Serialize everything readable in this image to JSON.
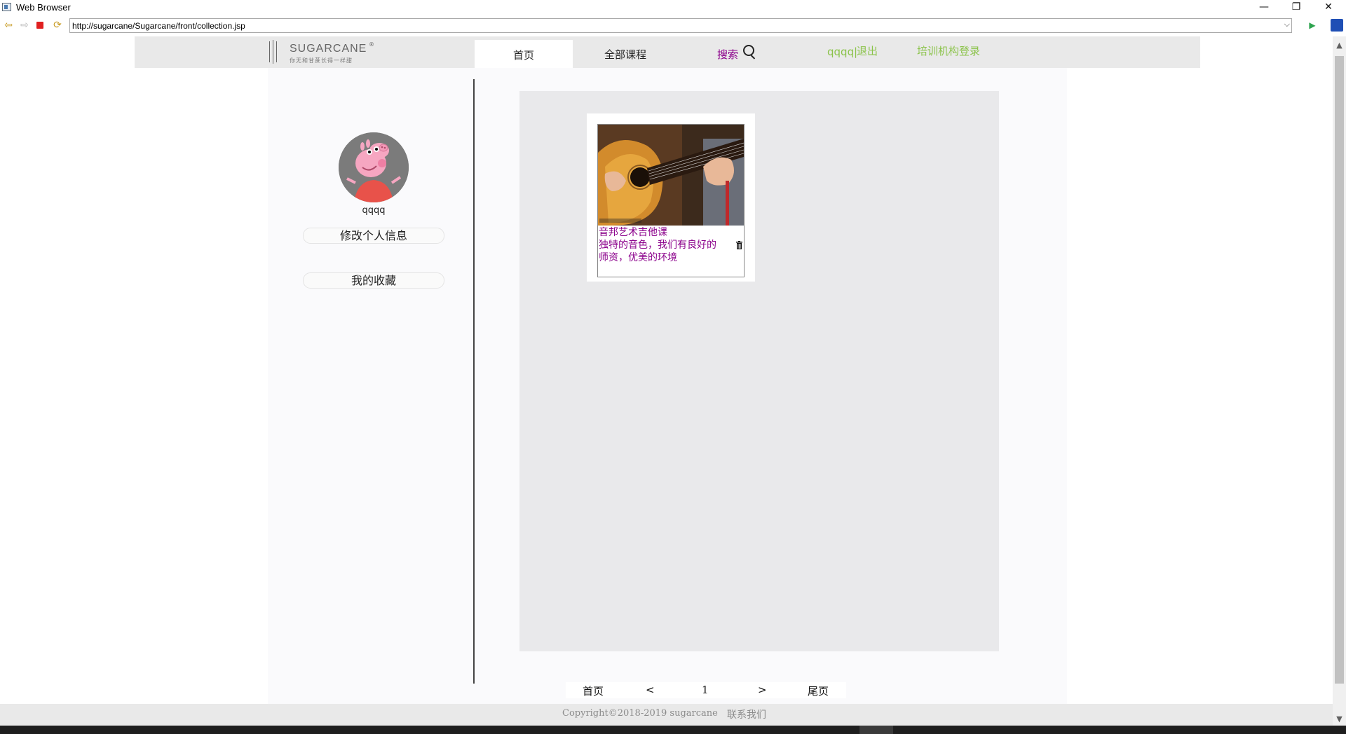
{
  "window": {
    "title": "Web Browser",
    "minimize_glyph": "—",
    "restore_glyph": "❐",
    "close_glyph": "✕"
  },
  "toolbar": {
    "url": "http://sugarcane/Sugarcane/front/collection.jsp",
    "back_glyph": "⇦",
    "forward_glyph": "⇨",
    "refresh_glyph": "⟳",
    "dropdown_glyph": "⌵",
    "go_glyph": "▶"
  },
  "header": {
    "logo_text": "SUGARCANE",
    "logo_reg": "®",
    "logo_slogan": "你无和甘蔗长得一样甜",
    "home_tab": "首页",
    "all_courses": "全部课程",
    "search": "搜索",
    "username": "qqqq",
    "separator": "|",
    "logout": "退出",
    "org_login": "培训机构登录"
  },
  "sidebar": {
    "username": "qqqq",
    "edit_profile": "修改个人信息",
    "my_favorites": "我的收藏"
  },
  "collection": {
    "items": [
      {
        "title": "音邦艺术吉他课",
        "description": "独特的音色，我们有良好的师资，优美的环境"
      }
    ]
  },
  "pagination": {
    "first": "首页",
    "prev": "<",
    "current": "1",
    "next": ">",
    "last": "尾页"
  },
  "footer": {
    "copyright": "Copyright©2018-2019   sugarcane",
    "contact": "联系我们"
  },
  "colors": {
    "accent_purple": "#8b008b",
    "accent_green": "#8bc34a",
    "nav_bg": "#e9e9e9"
  }
}
